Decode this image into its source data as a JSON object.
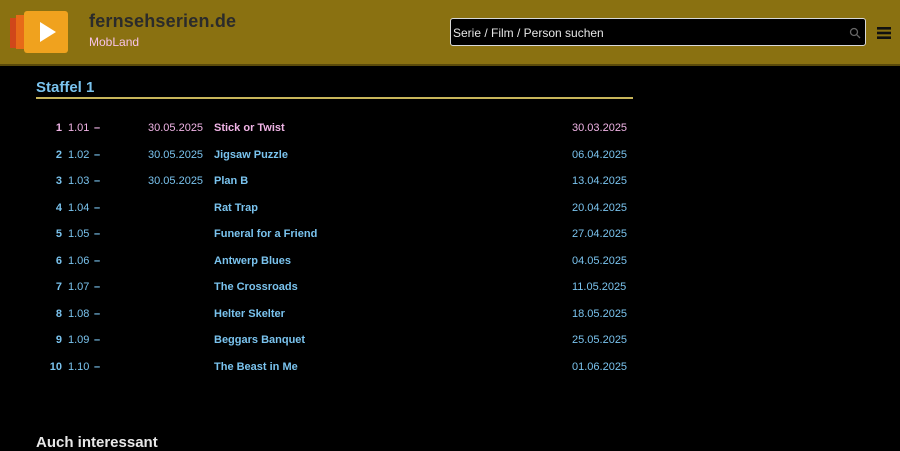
{
  "header": {
    "site_name": "fernsehserien.de",
    "show_name": "MobLand",
    "search_placeholder": "Serie / Film / Person suchen",
    "colors": {
      "bar": "#8a7111",
      "logo_orange": "#f0a21e",
      "show_name": "#f7c3e8"
    },
    "icons": [
      "play-logo-icon",
      "search-icon",
      "menu-icon"
    ]
  },
  "season": {
    "title": "Staffel 1",
    "episodes": [
      {
        "num": "1",
        "code": "1.01",
        "dash": "–",
        "date": "30.05.2025",
        "title": "Stick or Twist",
        "airdate": "30.03.2025"
      },
      {
        "num": "2",
        "code": "1.02",
        "dash": "–",
        "date": "30.05.2025",
        "title": "Jigsaw Puzzle",
        "airdate": "06.04.2025"
      },
      {
        "num": "3",
        "code": "1.03",
        "dash": "–",
        "date": "30.05.2025",
        "title": "Plan B",
        "airdate": "13.04.2025"
      },
      {
        "num": "4",
        "code": "1.04",
        "dash": "–",
        "date": "",
        "title": "Rat Trap",
        "airdate": "20.04.2025"
      },
      {
        "num": "5",
        "code": "1.05",
        "dash": "–",
        "date": "",
        "title": "Funeral for a Friend",
        "airdate": "27.04.2025"
      },
      {
        "num": "6",
        "code": "1.06",
        "dash": "–",
        "date": "",
        "title": "Antwerp Blues",
        "airdate": "04.05.2025"
      },
      {
        "num": "7",
        "code": "1.07",
        "dash": "–",
        "date": "",
        "title": "The Crossroads",
        "airdate": "11.05.2025"
      },
      {
        "num": "8",
        "code": "1.08",
        "dash": "–",
        "date": "",
        "title": "Helter Skelter",
        "airdate": "18.05.2025"
      },
      {
        "num": "9",
        "code": "1.09",
        "dash": "–",
        "date": "",
        "title": "Beggars Banquet",
        "airdate": "25.05.2025"
      },
      {
        "num": "10",
        "code": "1.10",
        "dash": "–",
        "date": "",
        "title": "The Beast in Me",
        "airdate": "01.06.2025"
      }
    ]
  },
  "also_interesting": "Auch interessant"
}
